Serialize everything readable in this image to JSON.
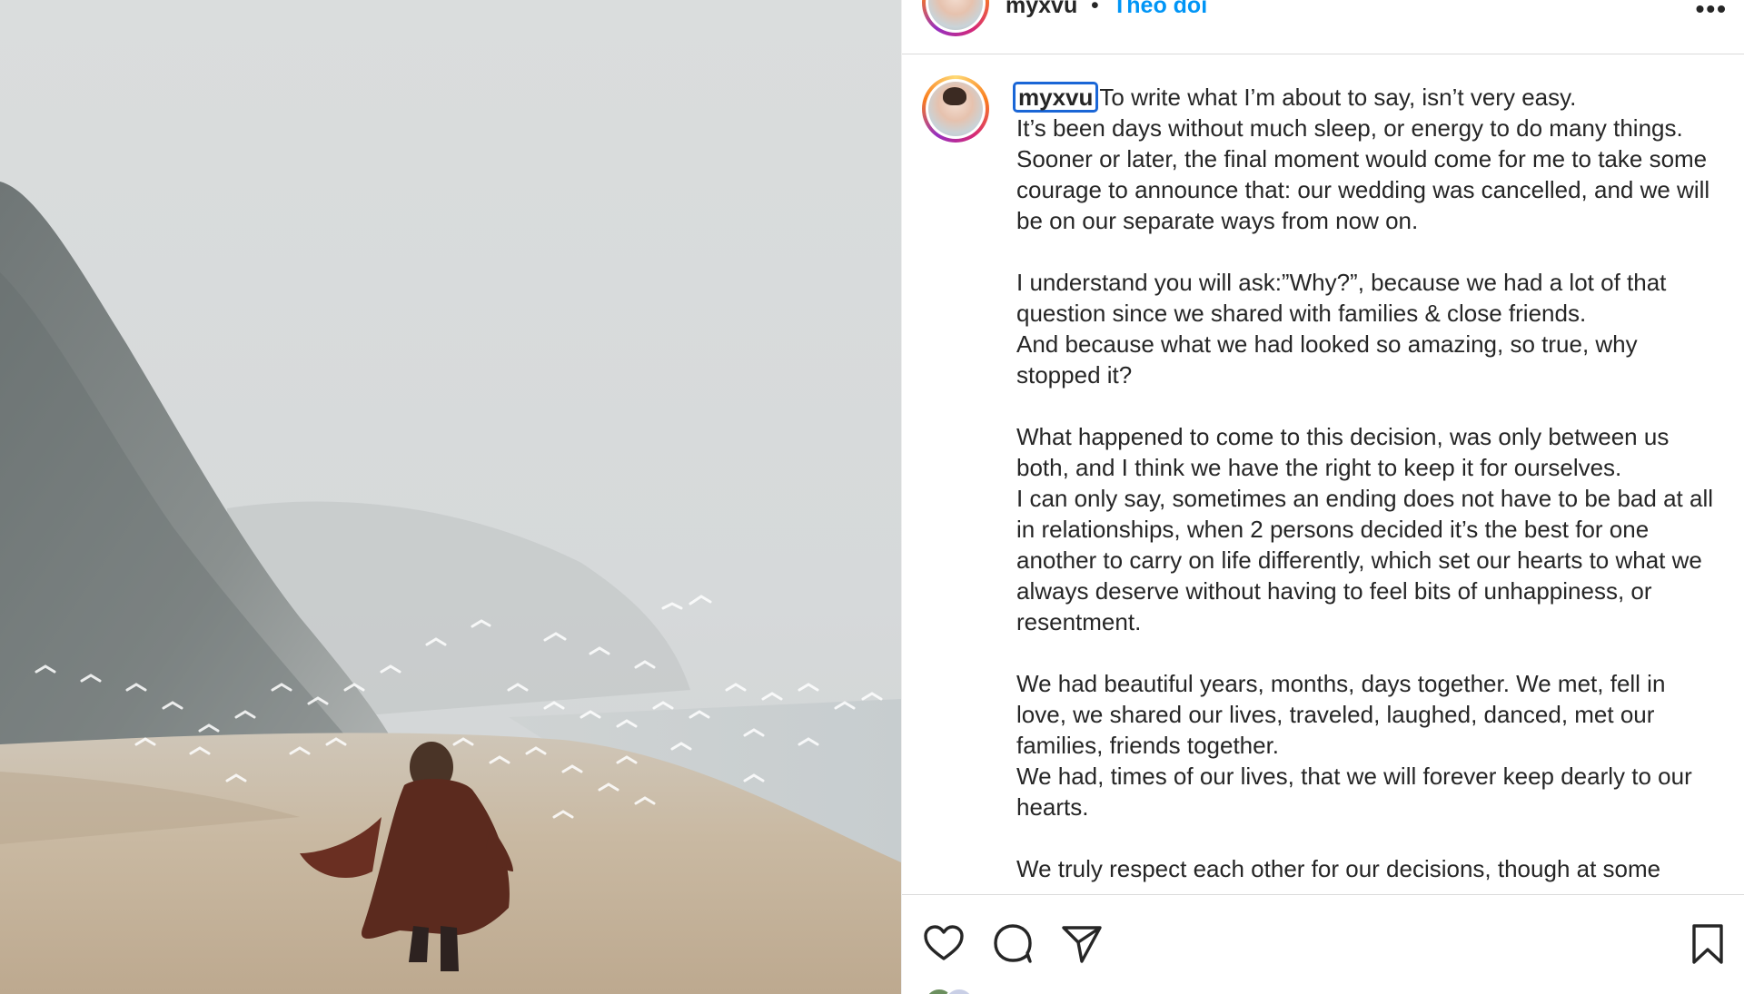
{
  "header": {
    "username": "myxvu",
    "separator": "•",
    "follow_label": "Theo dõi",
    "more_label": "•••"
  },
  "caption": {
    "username": "myxvu",
    "text": "To write what I’m about to say, isn’t very easy.\nIt’s been days without much sleep, or energy to do many things. Sooner or later, the final moment would come for me to take some courage to announce that: our wedding was cancelled, and we will be on our separate ways from now on.\n\nI understand you will ask:”Why?”, because we had a lot of that question since we shared with families & close friends.\nAnd because what we had looked so amazing, so true, why stopped it?\n\nWhat happened to come to this decision, was only between us both, and I think we have the right to keep it for ourselves.\nI can only say, sometimes an ending does not have to be bad at all in relationships, when 2 persons decided it’s the best for one another to carry on life differently, which set our hearts to what we always deserve without having to feel bits of unhappiness, or resentment.\n\nWe had beautiful years, months, days together. We met, fell in love, we shared our lives, traveled, laughed, danced, met our families, friends together.\nWe had, times of our lives, that we will forever keep dearly to our hearts.\n\nWe truly respect each other for our decisions, though at some"
  },
  "actions": {
    "like_icon": "heart-icon",
    "comment_icon": "comment-icon",
    "share_icon": "paper-plane-icon",
    "save_icon": "bookmark-icon"
  },
  "colors": {
    "follow_blue": "#0095f6",
    "focus_outline": "#1a66d6",
    "text": "#262626",
    "divider": "#dbdbdb"
  }
}
